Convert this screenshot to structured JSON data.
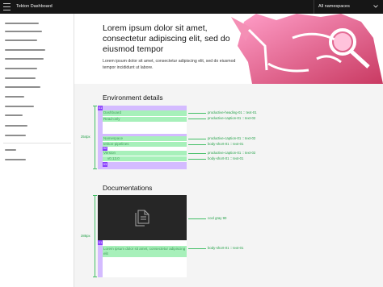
{
  "header": {
    "app_title": "Tekton Dashboard",
    "namespace_select": "All namespaces"
  },
  "hero": {
    "title": "Lorem ipsum dolor sit amet, consectetur adipiscing elit, sed do eiusmod tempor",
    "body": "Lorem ipsum dolor sit amet, consectetur adipiscing elit, sed do eiusmod tempor incididunt ut labore."
  },
  "environment": {
    "section_title": "Environment details",
    "height_label": "254px",
    "badges": [
      "01",
      "02",
      "03"
    ],
    "rows": [
      {
        "text": "Dashboard"
      },
      {
        "text": "Read-only"
      },
      {
        "text": "Namespace"
      },
      {
        "text": "tekton-pipelines"
      },
      {
        "text": "Version"
      },
      {
        "text": "v0.13.0"
      }
    ],
    "specs": [
      "productive-heading-01 :: text-01",
      "productive-caption-01 :: text-02",
      "productive-caption-01 :: text-02",
      "body-short-01 :: text-01",
      "productive-caption-01 :: text-02",
      "body-short-01 :: text-01"
    ]
  },
  "documentation": {
    "section_title": "Documentations",
    "height_label": "285px",
    "badge": "01",
    "card_text": "Lorem ipsum dolor sit amet, consectetur adipiscing elit",
    "specs": [
      "cool gray 90",
      "body-short-01 :: text-01"
    ]
  },
  "icons": [
    "menu-icon",
    "chevron-down-icon",
    "document-icon"
  ],
  "colors": {
    "header_bg": "#161616",
    "accent_purple": "#8a3ffc",
    "highlight_purple": "#d4bbff",
    "highlight_green": "#a7f0ba",
    "spec_green": "#24a148",
    "hero_gradient_start": "#ff7eb6",
    "hero_gradient_end": "#c93a62",
    "doc_card_dark": "#262626"
  }
}
